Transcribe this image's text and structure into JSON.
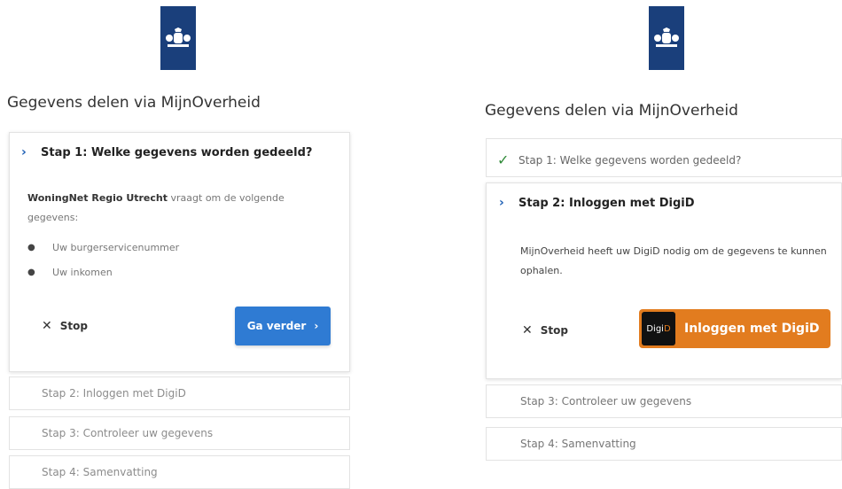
{
  "left": {
    "title": "Gegevens delen via MijnOverheid",
    "step1": {
      "label": "Stap 1: Welke gegevens worden gedeeld?",
      "requester": "WoningNet Regio Utrecht",
      "request_text": " vraagt om de volgende gegevens:",
      "items": [
        "Uw burgerservicenummer",
        "Uw inkomen"
      ],
      "stop_label": "Stop",
      "continue_label": "Ga verder"
    },
    "step2_label": "Stap 2: Inloggen met DigiD",
    "step3_label": "Stap 3: Controleer uw gegevens",
    "step4_label": "Stap 4: Samenvatting"
  },
  "right": {
    "title": "Gegevens delen via MijnOverheid",
    "step1_label": "Stap 1: Welke gegevens worden gedeeld?",
    "step2": {
      "label": "Stap 2: Inloggen met DigiD",
      "text": "MijnOverheid heeft uw DigiD nodig om de gegevens te kunnen ophalen.",
      "stop_label": "Stop",
      "login_label": "Inloggen met DigiD",
      "logo_text_a": "Digi",
      "logo_text_b": "D"
    },
    "step3_label": "Stap 3: Controleer uw gegevens",
    "step4_label": "Stap 4: Samenvatting"
  },
  "colors": {
    "logo_blue": "#1a3f7b",
    "button_blue": "#2f7bd3",
    "digid_orange": "#e27c1f",
    "check_green": "#2f8a38"
  },
  "icons": [
    "rijksoverheid-logo",
    "chevron-right-icon",
    "checkmark-icon",
    "close-icon",
    "digid-logo"
  ]
}
